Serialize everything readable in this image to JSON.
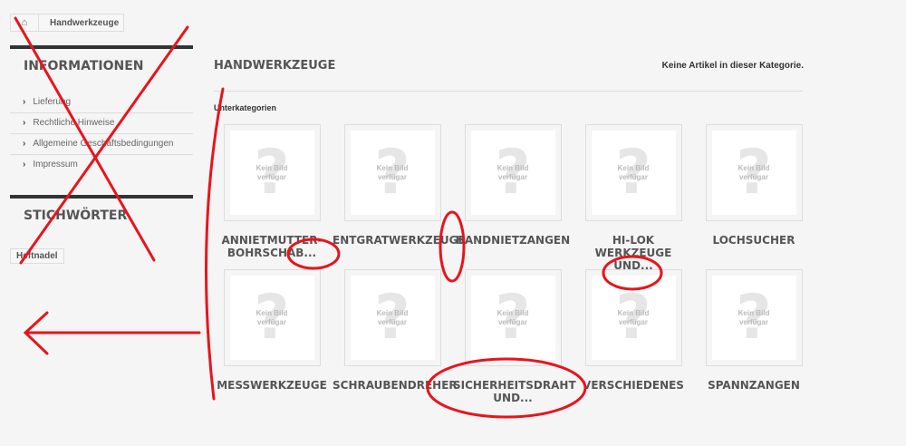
{
  "breadcrumb": {
    "home_icon": "home-icon",
    "current": "Handwerkzeuge"
  },
  "sidebar": {
    "info_title": "INFORMATIONEN",
    "links": [
      "Lieferung",
      "Rechtliche Hinweise",
      "Allgemeine Geschäftsbedingungen",
      "Impressum"
    ],
    "tags_title": "STICHWÖRTER",
    "tags": [
      "Heftnadel"
    ]
  },
  "main": {
    "title": "HANDWERKZEUGE",
    "no_articles": "Keine Artikel in dieser Kategorie.",
    "subcategories_label": "Unterkategorien",
    "placeholder": "Kein Bild verfügar",
    "categories": [
      "ANNIETMUTTER-BOHRSCHAB...",
      "ENTGRATWERKZEUGE",
      "HANDNIETZANGEN",
      "HI-LOK WERKZEUGE UND...",
      "LOCHSUCHER",
      "MESSWERKZEUGE",
      "SCHRAUBENDREHER",
      "SICHERHEITSDRAHT UND...",
      "VERSCHIEDENES",
      "SPANNZANGEN"
    ]
  },
  "annotation_color": "#e8141c"
}
